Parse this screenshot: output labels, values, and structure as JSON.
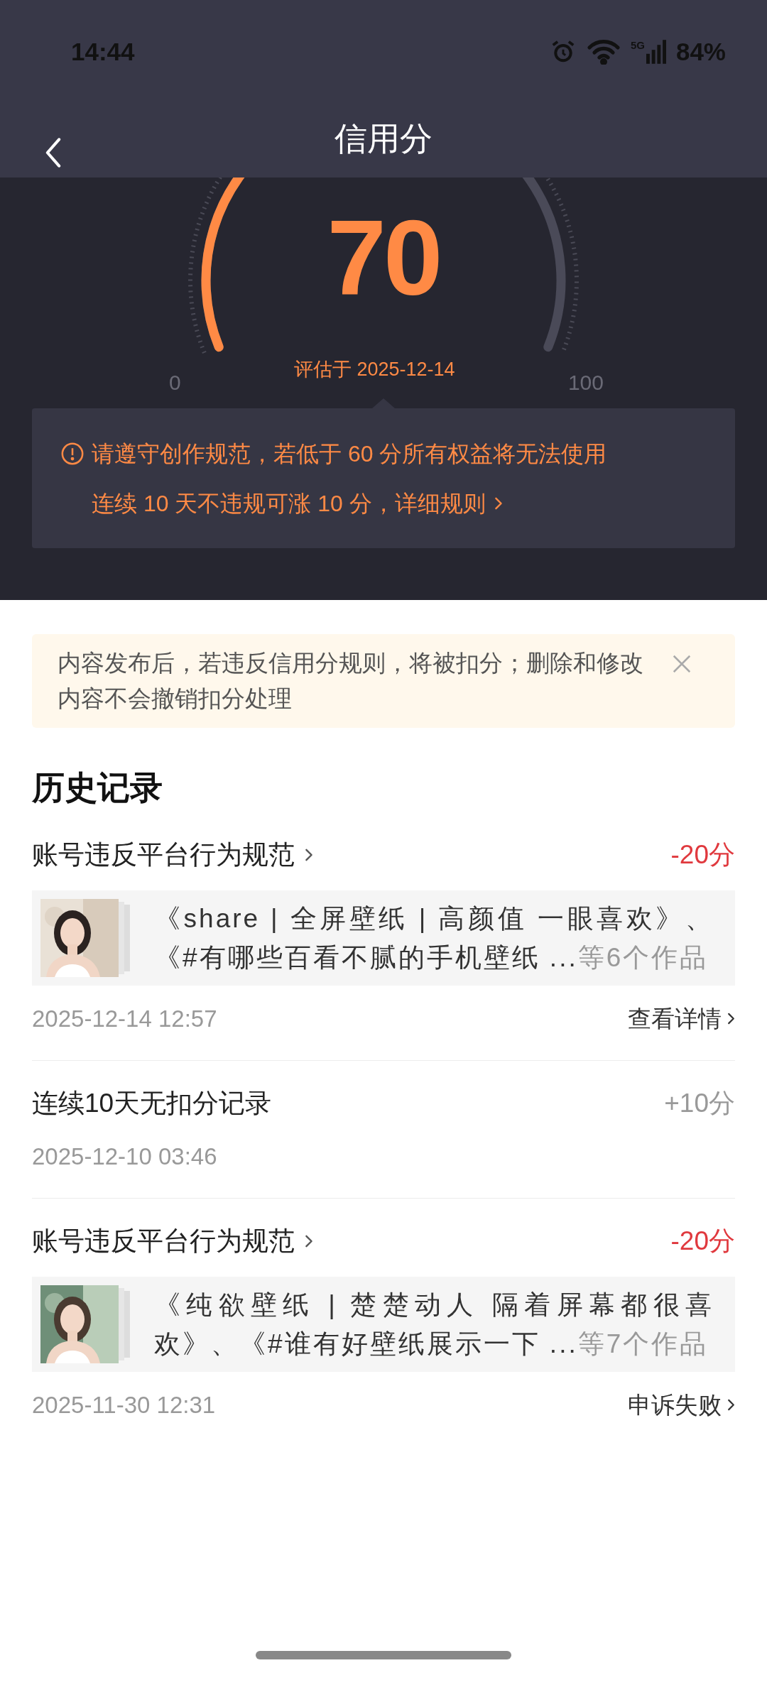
{
  "status_bar": {
    "time": "14:44",
    "network": "5G",
    "battery": "84%"
  },
  "header": {
    "title": "信用分"
  },
  "score": {
    "value": "70",
    "date_label": "评估于 2025-12-14",
    "min_label": "0",
    "max_label": "100"
  },
  "notice": {
    "lines": [
      {
        "kind": "warning",
        "text": "请遵守创作规范，若低于 60 分所有权益将无法使用"
      },
      {
        "kind": "link",
        "text": "连续 10 天不违规可涨 10 分，详细规则"
      }
    ]
  },
  "tip": {
    "text": "内容发布后，若违反信用分规则，将被扣分；删除和修改内容不会撤销扣分处理"
  },
  "history": {
    "title": "历史记录",
    "records": [
      {
        "kind": "penalty",
        "title": "账号违反平台行为规范",
        "points": "-20分",
        "works": {
          "titles": "《share | 全屏壁纸 | 高颜值 一眼喜欢》、《#有哪些百看不腻的手机壁纸 ...",
          "count": "等6个作品"
        },
        "time": "2025-12-14 12:57",
        "action": "查看详情"
      },
      {
        "kind": "bonus",
        "title": "连续10天无扣分记录",
        "points": "+10分",
        "time": "2025-12-10 03:46"
      },
      {
        "kind": "penalty",
        "title": "账号违反平台行为规范",
        "points": "-20分",
        "works": {
          "titles": "《纯欲壁纸 | 楚楚动人 隔着屏幕都很喜欢》、《#谁有好壁纸展示一下 ...",
          "count": "等7个作品"
        },
        "time": "2025-11-30 12:31",
        "action": "申诉失败"
      }
    ]
  }
}
